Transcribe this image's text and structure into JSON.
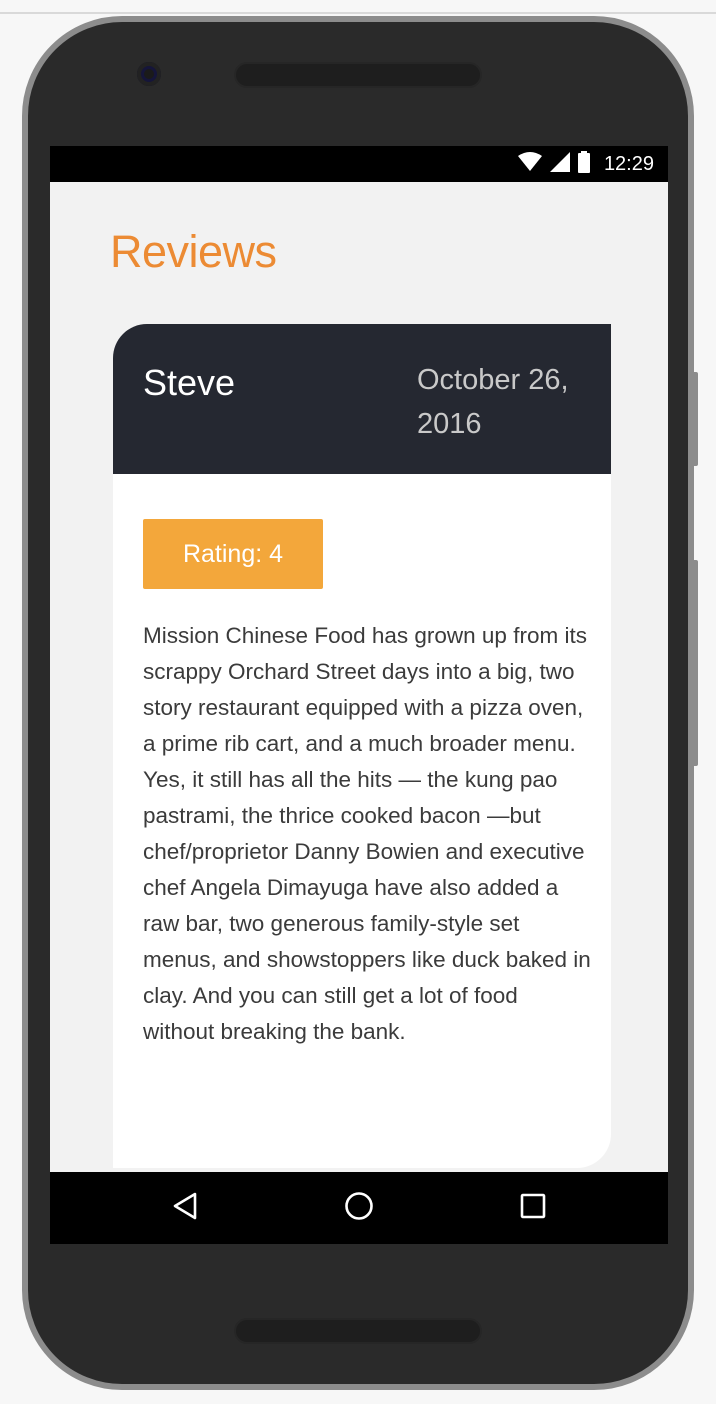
{
  "status_bar": {
    "time": "12:29",
    "icons": [
      "wifi-icon",
      "signal-icon",
      "battery-icon"
    ]
  },
  "page": {
    "title": "Reviews"
  },
  "review": {
    "reviewer": "Steve",
    "date": "October 26, 2016",
    "rating_label": "Rating: 4",
    "rating": 4,
    "comments": "Mission Chinese Food has grown up from its scrappy Orchard Street days into a big, two story restaurant equipped with a pizza oven, a prime rib cart, and a much broader menu. Yes, it still has all the hits — the kung pao pastrami, the thrice cooked bacon —but chef/proprietor Danny Bowien and executive chef Angela Dimayuga have also added a raw bar, two generous family-style set menus, and showstoppers like duck baked in clay. And you can still get a lot of food without breaking the bank."
  },
  "nav_bar": {
    "icons": [
      "back-icon",
      "home-icon",
      "recents-icon"
    ]
  },
  "colors": {
    "accent": "#ec8b34",
    "badge": "#f3a73b",
    "header_bg": "#252831"
  }
}
